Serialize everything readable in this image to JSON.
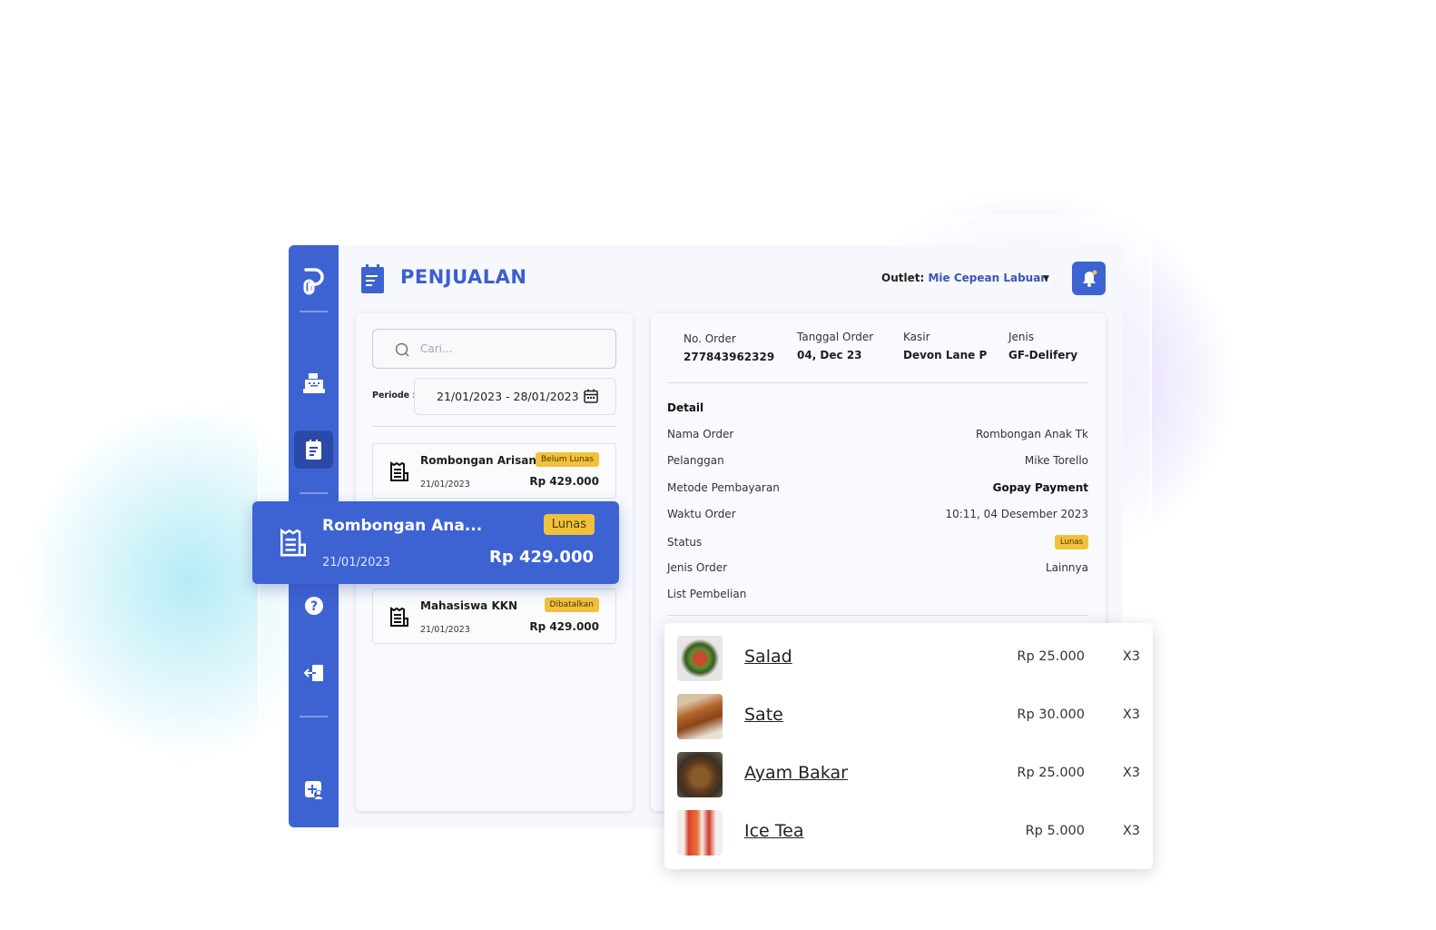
{
  "header": {
    "title": "PENJUALAN",
    "outlet_label": "Outlet:",
    "outlet_value": "Mie Cepean Labuan"
  },
  "colors": {
    "primary": "#3d63d3",
    "badge": "#f2c13b"
  },
  "sidebar": {
    "items": [
      {
        "icon": "logo-icon"
      },
      {
        "icon": "cash-register-icon"
      },
      {
        "icon": "sales-report-icon",
        "active": true
      },
      {
        "icon": "help-icon"
      },
      {
        "icon": "logout-icon"
      },
      {
        "icon": "user-settings-icon"
      }
    ]
  },
  "filters": {
    "search_placeholder": "Cari...",
    "period_label": "Periode :",
    "period_value": "21/01/2023 - 28/01/2023"
  },
  "orders": [
    {
      "name": "Rombongan Arisan",
      "date": "21/01/2023",
      "amount": "Rp 429.000",
      "status": "Belum Lunas"
    },
    {
      "name": "Rombongan Ana...",
      "date": "21/01/2023",
      "amount": "Rp 429.000",
      "status": "Lunas",
      "selected": true
    },
    {
      "name": "Mahasiswa KKN",
      "date": "21/01/2023",
      "amount": "Rp 429.000",
      "status": "Dibatalkan"
    }
  ],
  "detail": {
    "header": [
      {
        "label": "No. Order",
        "value": "277843962329"
      },
      {
        "label": "Tanggal Order",
        "value": "04, Dec 23"
      },
      {
        "label": "Kasir",
        "value": "Devon Lane P"
      },
      {
        "label": "Jenis",
        "value": "GF-Delifery"
      }
    ],
    "section_title": "Detail",
    "rows": [
      {
        "label": "Nama Order",
        "value": "Rombongan Anak Tk"
      },
      {
        "label": "Pelanggan",
        "value": "Mike Torello"
      },
      {
        "label": "Metode Pembayaran",
        "value": "Gopay Payment"
      },
      {
        "label": "Waktu Order",
        "value": "10:11, 04 Desember 2023"
      },
      {
        "label": "Status",
        "value": "Lunas"
      },
      {
        "label": "Jenis Order",
        "value": "Lainnya"
      }
    ],
    "list_title": "List Pembelian",
    "items": [
      {
        "name": "Salad",
        "price": "Rp 25.000",
        "qty": "X3"
      },
      {
        "name": "Sate",
        "price": "Rp 30.000",
        "qty": "X3"
      },
      {
        "name": "Ayam Bakar",
        "price": "Rp 25.000",
        "qty": "X3"
      },
      {
        "name": "Ice Tea",
        "price": "Rp 5.000",
        "qty": "X3"
      }
    ]
  }
}
